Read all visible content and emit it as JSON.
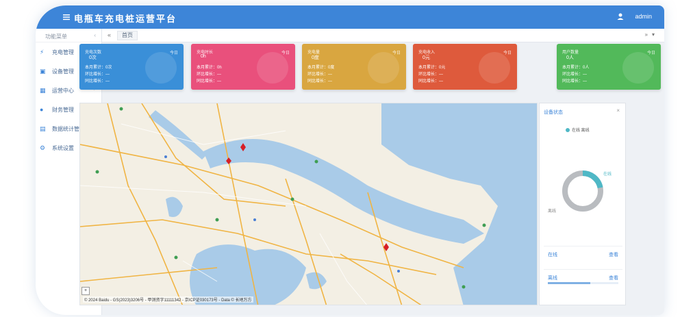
{
  "topbar": {
    "title": "电瓶车充电桩运营平台",
    "user": "admin"
  },
  "sidebar": {
    "header": "功能菜单",
    "items": [
      {
        "label": "充电管理",
        "icon": "plug-icon"
      },
      {
        "label": "设备管理",
        "icon": "device-icon"
      },
      {
        "label": "运营中心",
        "icon": "grid-icon"
      },
      {
        "label": "财务管理",
        "icon": "coin-icon"
      },
      {
        "label": "数据统计管理",
        "icon": "chart-icon"
      },
      {
        "label": "系统设置",
        "icon": "gear-icon"
      }
    ]
  },
  "tabs": {
    "active": "首页"
  },
  "cards": [
    {
      "name": "充电次数",
      "tag": "今日",
      "value": "0次",
      "line1": "本月累计：0次",
      "line2": "环比增长：—",
      "line3": "同比增长：—",
      "color": "#3a8fd8"
    },
    {
      "name": "充电时长",
      "tag": "今日",
      "value": "0h",
      "line1": "本月累计：0h",
      "line2": "环比增长：—",
      "line3": "同比增长：—",
      "color": "#e9507c"
    },
    {
      "name": "充电量",
      "tag": "今日",
      "value": "0度",
      "line1": "本月累计：0度",
      "line2": "环比增长：—",
      "line3": "同比增长：—",
      "color": "#d9a640"
    },
    {
      "name": "充电收入",
      "tag": "今日",
      "value": "0元",
      "line1": "本月累计：0元",
      "line2": "环比增长：—",
      "line3": "同比增长：—",
      "color": "#de5a3c"
    },
    {
      "name": "用户数量",
      "tag": "今日",
      "value": "0人",
      "line1": "本月累计：0人",
      "line2": "环比增长：—",
      "line3": "同比增长：—",
      "color": "#52b95a"
    }
  ],
  "map": {
    "copyright": "© 2024 Baidu - GS(2023)3206号 - 甲测资字11111342 - 京ICP证030173号 - Data © 长地万方"
  },
  "status_panel": {
    "title": "设备状态",
    "legend": "在线 离线",
    "label_online": "在线",
    "label_offline": "离线",
    "rows": [
      {
        "key": "在线",
        "value": "查看"
      },
      {
        "key": "离线",
        "value": "查看"
      }
    ],
    "colors": {
      "online": "#4fb8c6",
      "offline": "#b9bcc0"
    },
    "online_fraction": 0.22,
    "offline_progress": 0.6
  }
}
